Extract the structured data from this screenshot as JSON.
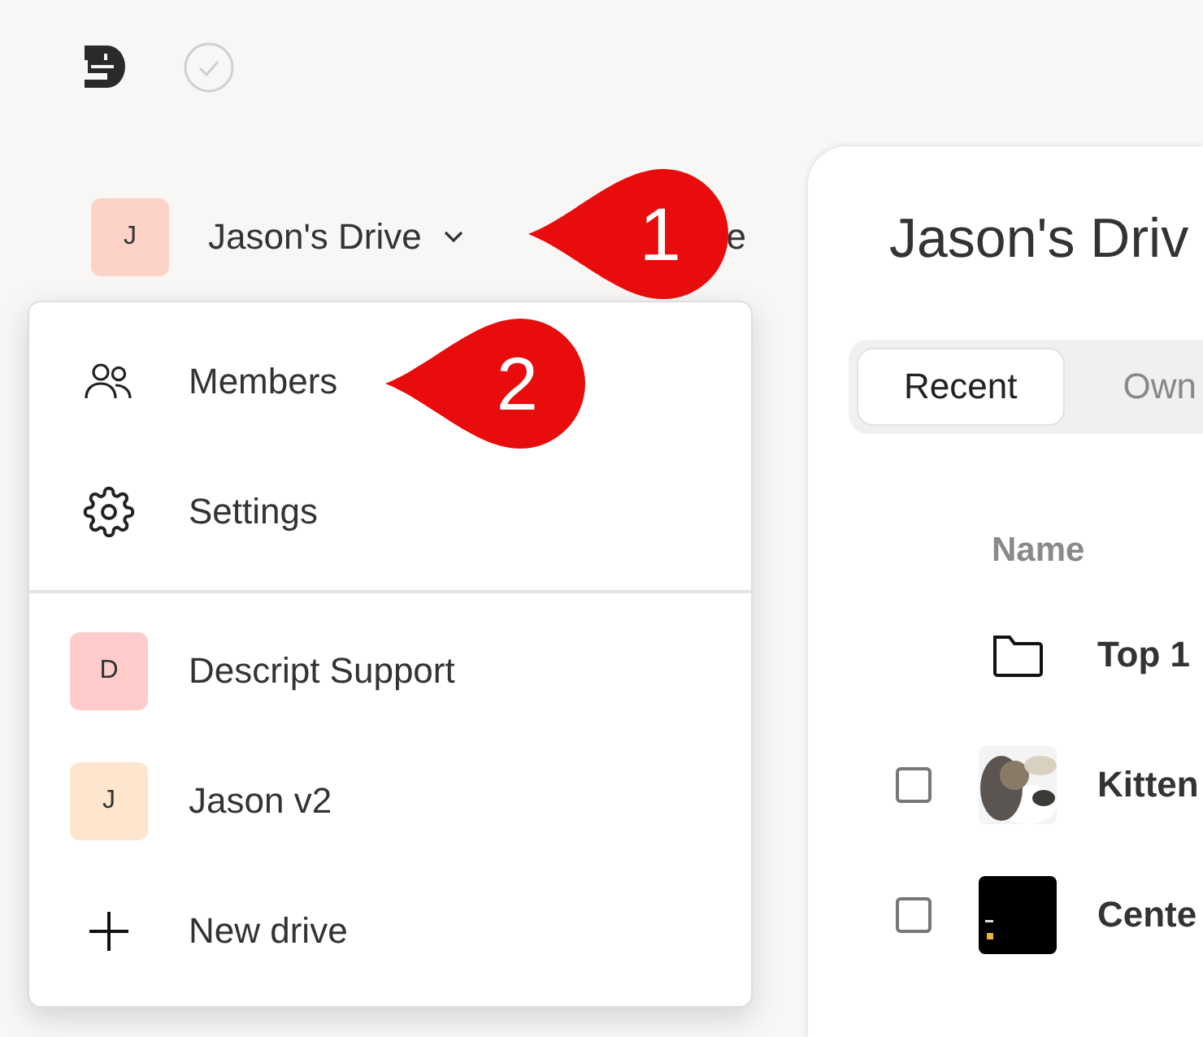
{
  "drive_switcher": {
    "avatar": "J",
    "color": "#fdd3c7",
    "name": "Jason's Drive",
    "trailing_text": "e",
    "expanded": true
  },
  "callouts": [
    {
      "label": "1"
    },
    {
      "label": "2"
    }
  ],
  "menu": {
    "actions": [
      {
        "kind": "members",
        "label": "Members"
      },
      {
        "kind": "settings",
        "label": "Settings"
      }
    ],
    "drives": [
      {
        "avatar": "D",
        "color": "#ffcccb",
        "label": "Descript Support"
      },
      {
        "avatar": "J",
        "color": "#fde6cd",
        "label": "Jason v2"
      }
    ],
    "new_drive": "New drive"
  },
  "main": {
    "title": "Jason's Driv",
    "tabs": [
      {
        "label": "Recent",
        "selected": true
      },
      {
        "label": "Own",
        "selected": false
      }
    ],
    "columns": [
      "Name"
    ],
    "rows": [
      {
        "kind": "folder",
        "name": "Top 1"
      },
      {
        "kind": "file",
        "name": "Kitten",
        "checked": false
      },
      {
        "kind": "file",
        "name": "Cente",
        "checked": false
      }
    ]
  }
}
